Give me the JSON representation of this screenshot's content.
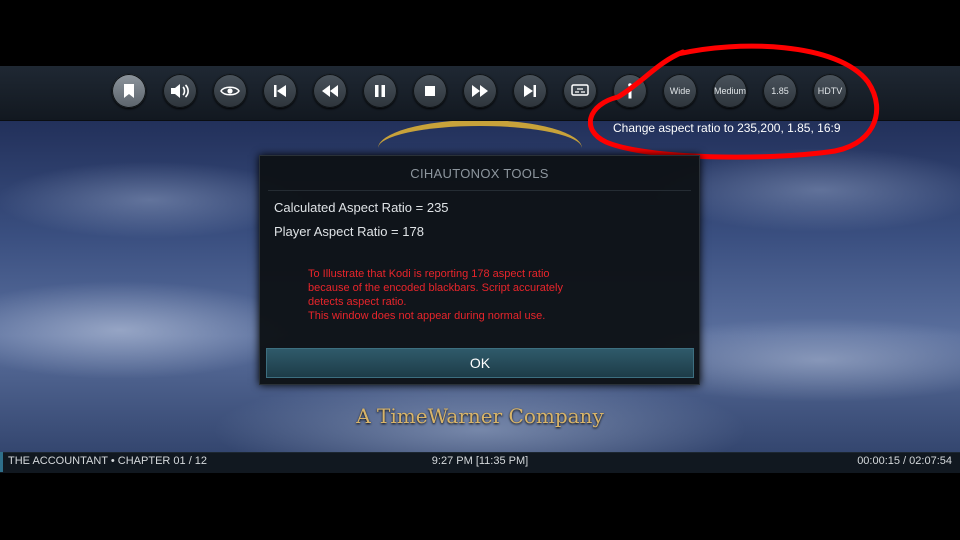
{
  "controls": {
    "buttons": [
      {
        "id": "bookmark",
        "icon": "bookmark-icon"
      },
      {
        "id": "volume",
        "icon": "speaker-icon"
      },
      {
        "id": "view",
        "icon": "eye-icon"
      },
      {
        "id": "previous",
        "icon": "skip-back-icon"
      },
      {
        "id": "rewind",
        "icon": "rewind-icon"
      },
      {
        "id": "pause",
        "icon": "pause-icon"
      },
      {
        "id": "stop",
        "icon": "stop-icon"
      },
      {
        "id": "fast-forward",
        "icon": "fast-forward-icon"
      },
      {
        "id": "next",
        "icon": "skip-forward-icon"
      },
      {
        "id": "subtitles",
        "icon": "subtitles-icon"
      },
      {
        "id": "info",
        "icon": "info-icon"
      }
    ],
    "aspect_buttons": [
      "Wide",
      "Medium",
      "1.85",
      "HDTV"
    ],
    "tooltip": "Change aspect ratio to 235,200, 1.85, 16:9",
    "annotation_color": "#ff0000"
  },
  "video": {
    "company_text": "A TimeWarner Company"
  },
  "dialog": {
    "title": "CIHAUTONOX TOOLS",
    "calculated": "Calculated Aspect Ratio = 235",
    "player": "Player Aspect Ratio = 178",
    "note_lines": [
      "To Illustrate that Kodi is reporting 178 aspect ratio",
      "because of the encoded blackbars. Script accurately",
      "detects aspect ratio.",
      "This window does not appear during normal use."
    ],
    "note_color": "#e8252b",
    "ok_label": "OK"
  },
  "status": {
    "title": "THE ACCOUNTANT • CHAPTER 01 / 12",
    "clock": "9:27 PM [11:35 PM]",
    "time": "00:00:15 / 02:07:54"
  }
}
